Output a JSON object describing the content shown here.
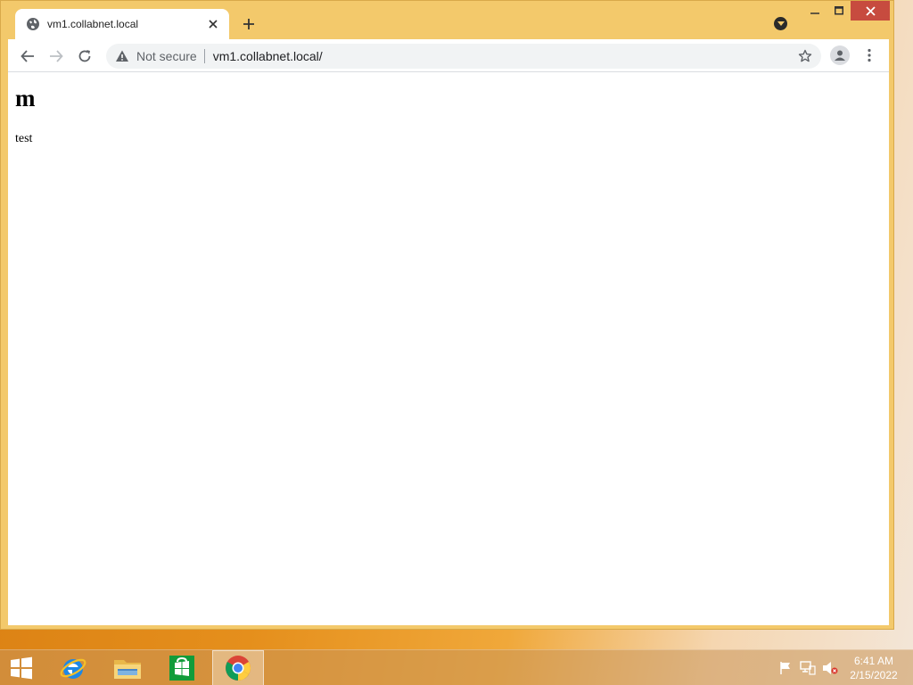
{
  "browser": {
    "tab": {
      "title": "vm1.collabnet.local",
      "favicon": "globe-icon"
    },
    "toolbar": {
      "security_label": "Not secure",
      "url": "vm1.collabnet.local/"
    }
  },
  "page": {
    "heading": "m",
    "paragraph": "test"
  },
  "taskbar": {
    "pinned": [
      "start-icon",
      "internet-explorer-icon",
      "file-explorer-icon",
      "store-icon",
      "chrome-icon"
    ],
    "tray": [
      "flag-icon",
      "network-icon",
      "speaker-muted-icon"
    ],
    "time": "6:41 AM",
    "date": "2/15/2022"
  },
  "colors": {
    "frame": "#f3c96b",
    "close_button": "#c74b3f",
    "desktop_accent": "#e58f1c"
  }
}
